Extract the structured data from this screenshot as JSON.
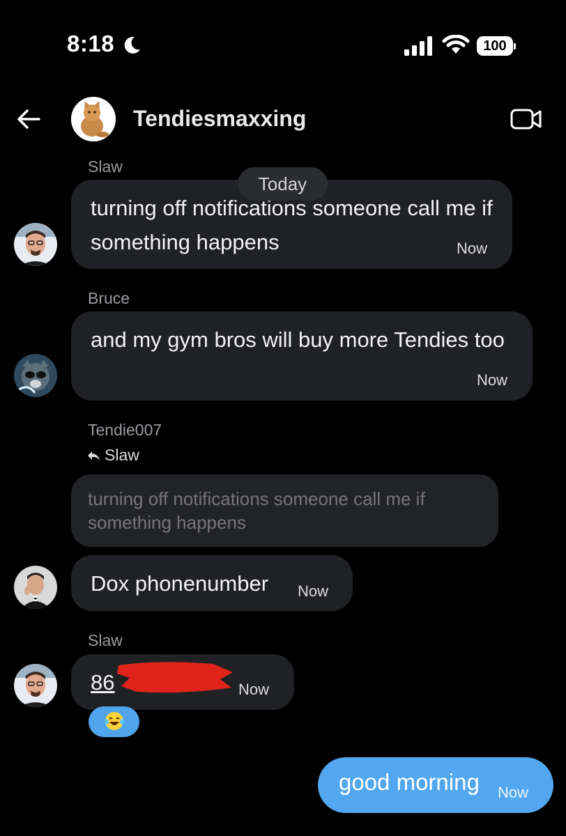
{
  "status_bar": {
    "time": "8:18",
    "battery": "100"
  },
  "header": {
    "title": "Tendiesmaxxing"
  },
  "date_divider": "Today",
  "messages": [
    {
      "sender": "Slaw",
      "text": "turning off notifications someone call me if something happens",
      "time": "Now"
    },
    {
      "sender": "Bruce",
      "text": "and my gym bros will buy more Tendies too",
      "time": "Now"
    },
    {
      "sender": "Tendie007",
      "reply_to": "Slaw",
      "quoted_text": "turning off notifications someone call me if something happens",
      "text": "Dox phonenumber",
      "time": "Now"
    },
    {
      "sender": "Slaw",
      "text": "86",
      "time": "Now",
      "reaction": "face-with-tears-of-joy"
    }
  ],
  "my_message": {
    "text": "good morning",
    "time": "Now"
  },
  "colors": {
    "background": "#000000",
    "bubble": "#202124",
    "my_bubble": "#52a7f0",
    "redaction": "#e0241b"
  }
}
